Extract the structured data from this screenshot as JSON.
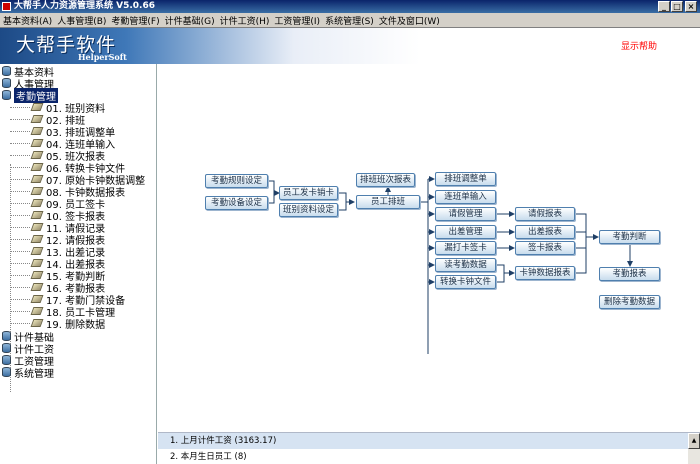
{
  "window": {
    "title": "大帮手人力资源管理系统 V5.0.66",
    "minimize": "_",
    "maximize": "□",
    "close": "×"
  },
  "menu": [
    "基本资料(A)",
    "人事管理(B)",
    "考勤管理(F)",
    "计件基础(G)",
    "计件工资(H)",
    "工资管理(I)",
    "系统管理(S)",
    "文件及窗口(W)"
  ],
  "banner": {
    "title": "大帮手软件",
    "subtitle": "HelperSoft",
    "help": "显示帮助"
  },
  "sidebar": {
    "root_items": [
      "基本资料",
      "人事管理",
      "考勤管理",
      "计件基础",
      "计件工资",
      "工资管理",
      "系统管理"
    ],
    "children": [
      "01. 班别资料",
      "02. 排班",
      "03. 排班调整单",
      "04. 连班单输入",
      "05. 班次报表",
      "06. 转换卡钟文件",
      "07. 原始卡钟数据调整",
      "08. 卡钟数据报表",
      "09. 员工签卡",
      "10. 签卡报表",
      "11. 请假记录",
      "12. 请假报表",
      "13. 出差记录",
      "14. 出差报表",
      "15. 考勤判断",
      "16. 考勤报表",
      "17. 考勤门禁设备",
      "18. 员工卡管理",
      "19. 删除数据"
    ]
  },
  "flow": {
    "attendance_rule": "考勤规则设定",
    "attendance_device": "考勤设备设定",
    "issue_card": "员工发卡销卡",
    "shift_data": "班别资料设定",
    "shift_report": "排班班次报表",
    "staff_schedule": "员工排班",
    "adjust_schedule": "排班调整单",
    "continuous_shift": "连班单输入",
    "leave_mgmt": "请假管理",
    "trip_mgmt": "出差管理",
    "missed_punch": "漏打卡签卡",
    "read_data": "读考勤数据",
    "convert_file": "转换卡钟文件",
    "leave_report": "请假报表",
    "trip_report": "出差报表",
    "sign_report": "签卡报表",
    "clock_report": "卡钟数据报表",
    "judge": "考勤判断",
    "att_report": "考勤报表",
    "delete_data": "删除考勤数据"
  },
  "bottom": {
    "row1": "1.  上月计件工资 (3163.17)",
    "row2": "2.  本月生日员工 (8)"
  }
}
